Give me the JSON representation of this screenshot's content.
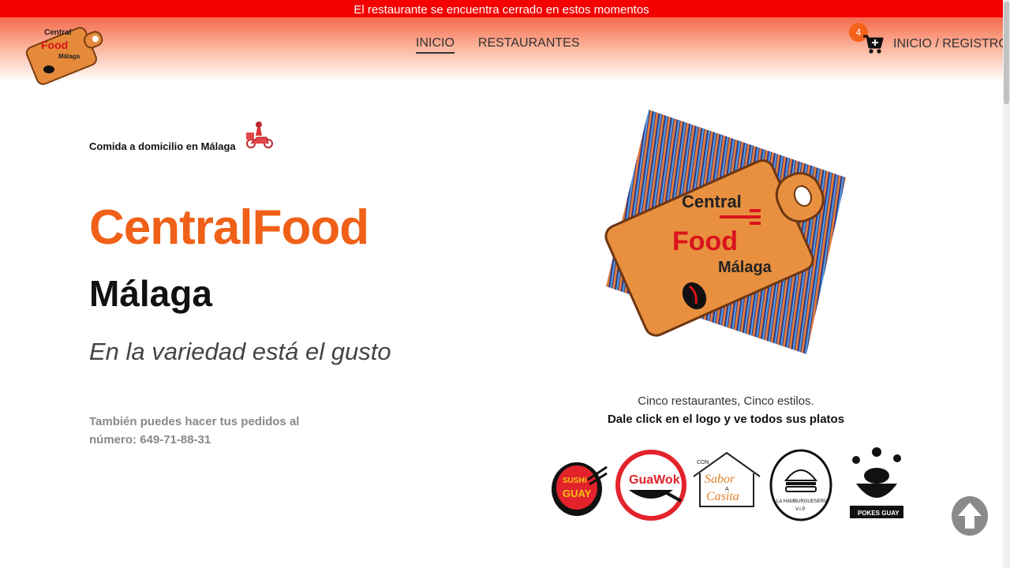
{
  "banner": {
    "text": "El restaurante se encuentra cerrado en estos momentos",
    "color": "#f40000"
  },
  "header": {
    "logo": {
      "line1": "Central",
      "line2": "Food",
      "line3": "Málaga"
    },
    "nav": [
      {
        "label": "INICIO",
        "active": true
      },
      {
        "label": "RESTAURANTES",
        "active": false
      }
    ],
    "cart": {
      "count": "4",
      "icon": "cart-plus-icon"
    },
    "login_label": "INICIO / REGISTRO"
  },
  "hero": {
    "delivery_text": "Comida a domicilio en Málaga",
    "title": "CentralFood",
    "subtitle": "Málaga",
    "slogan": "En la variedad está el gusto",
    "phone_text": "También puedes hacer tus pedidos al número: 649-71-88-31",
    "accent_color": "#f06018"
  },
  "big_logo": {
    "line1": "Central",
    "line2": "Food",
    "line3": "Málaga"
  },
  "restaurants": {
    "intro": "Cinco restaurantes, Cinco estilos.",
    "cta": "Dale click en el logo y ve todos sus platos",
    "logos": [
      {
        "line1": "SUSHI",
        "line2": "GUAY"
      },
      {
        "name": "GuaWok"
      },
      {
        "top": "CON",
        "line1": "Sabor",
        "mid": "A",
        "line2": "Casita"
      },
      {
        "caption": "LA HAMBURGUESERÍA",
        "sub": "V.I.P"
      },
      {
        "name": "POKES GUAY"
      }
    ]
  }
}
